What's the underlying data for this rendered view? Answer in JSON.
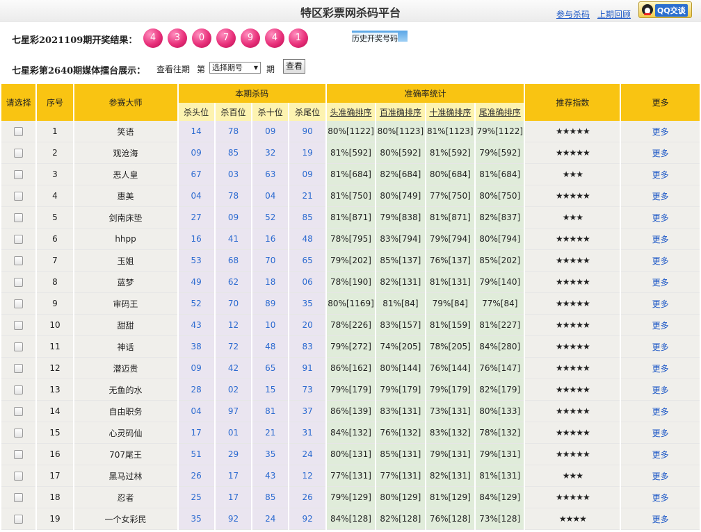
{
  "header": {
    "title": "特区彩票网杀码平台",
    "link_join": "参与杀码",
    "link_last": "上期回顾",
    "qq_label": "QQ交谈"
  },
  "draw": {
    "label": "七星彩2021109期开奖结果：",
    "balls": [
      "4",
      "3",
      "0",
      "7",
      "9",
      "4",
      "1"
    ],
    "history_link": "历史开奖号码"
  },
  "query": {
    "label": "七星彩第2640期媒体擂台展示：",
    "view_past": "查看往期",
    "di": "第",
    "select_value": "选择期号",
    "qi": "期",
    "button": "查看"
  },
  "table": {
    "headers": {
      "select": "请选择",
      "no": "序号",
      "master": "参赛大师",
      "kill": "本期杀码",
      "accuracy": "准确率统计",
      "rating": "推荐指数",
      "more": "更多"
    },
    "kill_cols": [
      "杀头位",
      "杀百位",
      "杀十位",
      "杀尾位"
    ],
    "acc_cols": [
      "头准确排序",
      "百准确排序",
      "十准确排序",
      "尾准确排序"
    ],
    "more_label": "更多",
    "rows": [
      {
        "no": "1",
        "name": "笑语",
        "k": [
          "14",
          "78",
          "09",
          "90"
        ],
        "a": [
          "80%[1122]",
          "80%[1123]",
          "81%[1123]",
          "79%[1122]"
        ],
        "stars": "★★★★★"
      },
      {
        "no": "2",
        "name": "观沧海",
        "k": [
          "09",
          "85",
          "32",
          "19"
        ],
        "a": [
          "81%[592]",
          "80%[592]",
          "81%[592]",
          "79%[592]"
        ],
        "stars": "★★★★★"
      },
      {
        "no": "3",
        "name": "恶人皇",
        "k": [
          "67",
          "03",
          "63",
          "09"
        ],
        "a": [
          "81%[684]",
          "82%[684]",
          "80%[684]",
          "81%[684]"
        ],
        "stars": "★★★"
      },
      {
        "no": "4",
        "name": "惠美",
        "k": [
          "04",
          "78",
          "04",
          "21"
        ],
        "a": [
          "81%[750]",
          "80%[749]",
          "77%[750]",
          "80%[750]"
        ],
        "stars": "★★★★★"
      },
      {
        "no": "5",
        "name": "剑南床垫",
        "k": [
          "27",
          "09",
          "52",
          "85"
        ],
        "a": [
          "81%[871]",
          "79%[838]",
          "81%[871]",
          "82%[837]"
        ],
        "stars": "★★★"
      },
      {
        "no": "6",
        "name": "hhpp",
        "k": [
          "16",
          "41",
          "16",
          "48"
        ],
        "a": [
          "78%[795]",
          "83%[794]",
          "79%[794]",
          "80%[794]"
        ],
        "stars": "★★★★★"
      },
      {
        "no": "7",
        "name": "玉姐",
        "k": [
          "53",
          "68",
          "70",
          "65"
        ],
        "a": [
          "79%[202]",
          "85%[137]",
          "76%[137]",
          "85%[202]"
        ],
        "stars": "★★★★★"
      },
      {
        "no": "8",
        "name": "蓝梦",
        "k": [
          "49",
          "62",
          "18",
          "06"
        ],
        "a": [
          "78%[190]",
          "82%[131]",
          "81%[131]",
          "79%[140]"
        ],
        "stars": "★★★★★"
      },
      {
        "no": "9",
        "name": "审码王",
        "k": [
          "52",
          "70",
          "89",
          "35"
        ],
        "a": [
          "80%[1169]",
          "81%[84]",
          "79%[84]",
          "77%[84]"
        ],
        "stars": "★★★★★"
      },
      {
        "no": "10",
        "name": "甜甜",
        "k": [
          "43",
          "12",
          "10",
          "20"
        ],
        "a": [
          "78%[226]",
          "83%[157]",
          "81%[159]",
          "81%[227]"
        ],
        "stars": "★★★★★"
      },
      {
        "no": "11",
        "name": "神话",
        "k": [
          "38",
          "72",
          "48",
          "83"
        ],
        "a": [
          "79%[272]",
          "74%[205]",
          "78%[205]",
          "84%[280]"
        ],
        "stars": "★★★★★"
      },
      {
        "no": "12",
        "name": "潜迈贵",
        "k": [
          "09",
          "42",
          "65",
          "91"
        ],
        "a": [
          "86%[162]",
          "80%[144]",
          "76%[144]",
          "76%[147]"
        ],
        "stars": "★★★★★"
      },
      {
        "no": "13",
        "name": "无鱼的水",
        "k": [
          "28",
          "02",
          "15",
          "73"
        ],
        "a": [
          "79%[179]",
          "79%[179]",
          "79%[179]",
          "82%[179]"
        ],
        "stars": "★★★★★"
      },
      {
        "no": "14",
        "name": "自由职务",
        "k": [
          "04",
          "97",
          "81",
          "37"
        ],
        "a": [
          "86%[139]",
          "83%[131]",
          "73%[131]",
          "80%[133]"
        ],
        "stars": "★★★★★"
      },
      {
        "no": "15",
        "name": "心灵码仙",
        "k": [
          "17",
          "01",
          "21",
          "31"
        ],
        "a": [
          "84%[132]",
          "76%[132]",
          "83%[132]",
          "78%[132]"
        ],
        "stars": "★★★★★"
      },
      {
        "no": "16",
        "name": "707尾王",
        "k": [
          "51",
          "29",
          "35",
          "24"
        ],
        "a": [
          "80%[131]",
          "85%[131]",
          "79%[131]",
          "79%[131]"
        ],
        "stars": "★★★★★"
      },
      {
        "no": "17",
        "name": "黑马过林",
        "k": [
          "26",
          "17",
          "43",
          "12"
        ],
        "a": [
          "77%[131]",
          "77%[131]",
          "82%[131]",
          "81%[131]"
        ],
        "stars": "★★★"
      },
      {
        "no": "18",
        "name": "忍者",
        "k": [
          "25",
          "17",
          "85",
          "26"
        ],
        "a": [
          "79%[129]",
          "80%[129]",
          "81%[129]",
          "84%[129]"
        ],
        "stars": "★★★★★"
      },
      {
        "no": "19",
        "name": "一个女彩民",
        "k": [
          "35",
          "92",
          "24",
          "92"
        ],
        "a": [
          "84%[128]",
          "82%[128]",
          "76%[128]",
          "73%[128]"
        ],
        "stars": "★★★★"
      }
    ]
  }
}
